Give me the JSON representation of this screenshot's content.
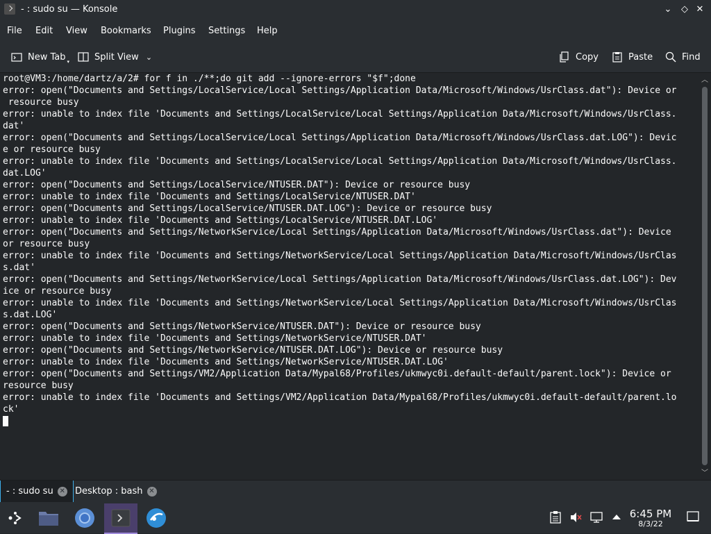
{
  "window": {
    "title": "- : sudo su — Konsole",
    "buttons": {
      "minimize": "⌄",
      "maximize": "◇",
      "close": "✕"
    }
  },
  "menu": [
    "File",
    "Edit",
    "View",
    "Bookmarks",
    "Plugins",
    "Settings",
    "Help"
  ],
  "toolbar": {
    "new_tab": "New Tab",
    "split_view": "Split View",
    "copy": "Copy",
    "paste": "Paste",
    "find": "Find"
  },
  "terminal": {
    "lines": [
      "root@VM3:/home/dartz/a/2# for f in ./**;do git add --ignore-errors \"$f\";done",
      "error: open(\"Documents and Settings/LocalService/Local Settings/Application Data/Microsoft/Windows/UsrClass.dat\"): Device or",
      " resource busy",
      "error: unable to index file 'Documents and Settings/LocalService/Local Settings/Application Data/Microsoft/Windows/UsrClass.",
      "dat'",
      "error: open(\"Documents and Settings/LocalService/Local Settings/Application Data/Microsoft/Windows/UsrClass.dat.LOG\"): Devic",
      "e or resource busy",
      "error: unable to index file 'Documents and Settings/LocalService/Local Settings/Application Data/Microsoft/Windows/UsrClass.",
      "dat.LOG'",
      "error: open(\"Documents and Settings/LocalService/NTUSER.DAT\"): Device or resource busy",
      "error: unable to index file 'Documents and Settings/LocalService/NTUSER.DAT'",
      "error: open(\"Documents and Settings/LocalService/NTUSER.DAT.LOG\"): Device or resource busy",
      "error: unable to index file 'Documents and Settings/LocalService/NTUSER.DAT.LOG'",
      "error: open(\"Documents and Settings/NetworkService/Local Settings/Application Data/Microsoft/Windows/UsrClass.dat\"): Device",
      "or resource busy",
      "error: unable to index file 'Documents and Settings/NetworkService/Local Settings/Application Data/Microsoft/Windows/UsrClas",
      "s.dat'",
      "error: open(\"Documents and Settings/NetworkService/Local Settings/Application Data/Microsoft/Windows/UsrClass.dat.LOG\"): Dev",
      "ice or resource busy",
      "error: unable to index file 'Documents and Settings/NetworkService/Local Settings/Application Data/Microsoft/Windows/UsrClas",
      "s.dat.LOG'",
      "error: open(\"Documents and Settings/NetworkService/NTUSER.DAT\"): Device or resource busy",
      "error: unable to index file 'Documents and Settings/NetworkService/NTUSER.DAT'",
      "error: open(\"Documents and Settings/NetworkService/NTUSER.DAT.LOG\"): Device or resource busy",
      "error: unable to index file 'Documents and Settings/NetworkService/NTUSER.DAT.LOG'",
      "error: open(\"Documents and Settings/VM2/Application Data/Mypal68/Profiles/ukmwyc0i.default-default/parent.lock\"): Device or",
      "resource busy",
      "error: unable to index file 'Documents and Settings/VM2/Application Data/Mypal68/Profiles/ukmwyc0i.default-default/parent.lo",
      "ck'"
    ]
  },
  "tabs": [
    {
      "label": "- : sudo su",
      "active": true
    },
    {
      "label": "Desktop : bash",
      "active": false
    }
  ],
  "taskbar": {
    "apps": [
      "application-launcher-icon",
      "file-manager-icon",
      "chromium-icon",
      "konsole-icon",
      "browser-icon"
    ]
  },
  "clock": {
    "time": "6:45 PM",
    "date": "8/3/22"
  },
  "colors": {
    "accent": "#3daee9",
    "active_task": "#4a3f6b",
    "background": "#232629",
    "chrome": "#2a2e32"
  }
}
